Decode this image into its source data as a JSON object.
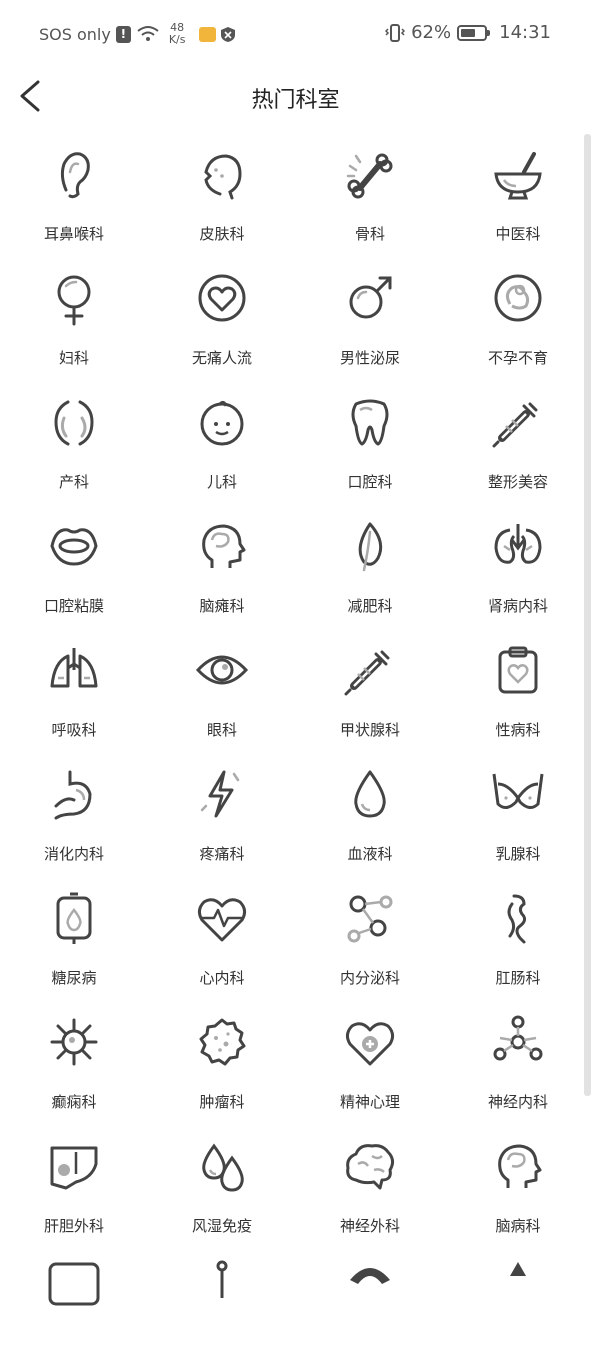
{
  "status_bar": {
    "carrier": "SOS only",
    "net_speed_value": "48",
    "net_speed_unit": "K/s",
    "battery": "62%",
    "battery_level": 0.62,
    "time": "14:31"
  },
  "header": {
    "title": "热门科室"
  },
  "colors": {
    "icon_stroke": "#444444",
    "icon_accent": "#aaaaaa",
    "scrollbar": "#e2e2e2"
  },
  "departments": [
    {
      "label": "耳鼻喉科",
      "icon": "ear-icon"
    },
    {
      "label": "皮肤科",
      "icon": "face-icon"
    },
    {
      "label": "骨科",
      "icon": "bone-icon"
    },
    {
      "label": "中医科",
      "icon": "mortar-icon"
    },
    {
      "label": "妇科",
      "icon": "female-icon"
    },
    {
      "label": "无痛人流",
      "icon": "heart-circle-icon"
    },
    {
      "label": "男性泌尿",
      "icon": "male-icon"
    },
    {
      "label": "不孕不育",
      "icon": "fetus-icon"
    },
    {
      "label": "产科",
      "icon": "uterus-icon"
    },
    {
      "label": "儿科",
      "icon": "baby-icon"
    },
    {
      "label": "口腔科",
      "icon": "tooth-icon"
    },
    {
      "label": "整形美容",
      "icon": "syringe-icon"
    },
    {
      "label": "口腔粘膜",
      "icon": "mouth-icon"
    },
    {
      "label": "脑瘫科",
      "icon": "head-brain-icon"
    },
    {
      "label": "减肥科",
      "icon": "leaf-icon"
    },
    {
      "label": "肾病内科",
      "icon": "kidney-icon"
    },
    {
      "label": "呼吸科",
      "icon": "lungs-icon"
    },
    {
      "label": "眼科",
      "icon": "eye-icon"
    },
    {
      "label": "甲状腺科",
      "icon": "syringe-icon"
    },
    {
      "label": "性病科",
      "icon": "clipboard-heart-icon"
    },
    {
      "label": "消化内科",
      "icon": "stomach-icon"
    },
    {
      "label": "疼痛科",
      "icon": "lightning-icon"
    },
    {
      "label": "血液科",
      "icon": "drop-icon"
    },
    {
      "label": "乳腺科",
      "icon": "bra-icon"
    },
    {
      "label": "糖尿病",
      "icon": "iv-bag-icon"
    },
    {
      "label": "心内科",
      "icon": "heartbeat-icon"
    },
    {
      "label": "内分泌科",
      "icon": "molecule-icon"
    },
    {
      "label": "肛肠科",
      "icon": "intestine-icon"
    },
    {
      "label": "癫痫科",
      "icon": "virus-icon"
    },
    {
      "label": "肿瘤科",
      "icon": "tumor-icon"
    },
    {
      "label": "精神心理",
      "icon": "heart-cross-icon"
    },
    {
      "label": "神经内科",
      "icon": "neuron-icon"
    },
    {
      "label": "肝胆外科",
      "icon": "liver-icon"
    },
    {
      "label": "风湿免疫",
      "icon": "drops-icon"
    },
    {
      "label": "神经外科",
      "icon": "brain-icon"
    },
    {
      "label": "脑病科",
      "icon": "head-brain-icon"
    }
  ]
}
